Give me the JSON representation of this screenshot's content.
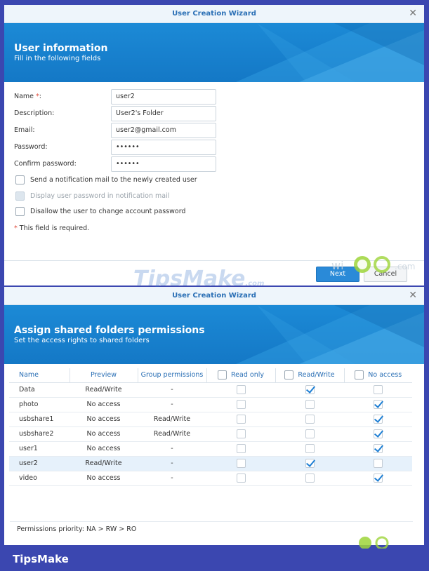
{
  "wizard1": {
    "title": "User Creation Wizard",
    "banner_title": "User information",
    "banner_subtitle": "Fill in the following fields",
    "fields": [
      {
        "label": "Name ",
        "required_mark": "*",
        "colon": ":",
        "value": "user2"
      },
      {
        "label": "Description:",
        "required_mark": "",
        "colon": "",
        "value": "User2's Folder"
      },
      {
        "label": "Email:",
        "required_mark": "",
        "colon": "",
        "value": "user2@gmail.com"
      },
      {
        "label": "Password:",
        "required_mark": "",
        "colon": "",
        "value": "••••••"
      },
      {
        "label": "Confirm password:",
        "required_mark": "",
        "colon": "",
        "value": "••••••"
      }
    ],
    "checkboxes": [
      {
        "label": "Send a notification mail to the newly created user",
        "checked": false,
        "disabled": false
      },
      {
        "label": "Display user password in notification mail",
        "checked": false,
        "disabled": true
      },
      {
        "label": "Disallow the user to change account password",
        "checked": false,
        "disabled": false
      }
    ],
    "required_note_mark": "*",
    "required_note": " This field is required.",
    "next_label": "Next",
    "cancel_label": "Cancel"
  },
  "watermark": {
    "text": "TipsMake",
    "suffix": ".com"
  },
  "logo_text": "wi Z .com",
  "wizard2": {
    "title": "User Creation Wizard",
    "banner_title": "Assign shared folders permissions",
    "banner_subtitle": "Set the access rights to shared folders",
    "columns": {
      "name": "Name",
      "preview": "Preview",
      "group": "Group permissions",
      "read_only": "Read only",
      "read_write": "Read/Write",
      "no_access": "No access"
    },
    "rows": [
      {
        "name": "Data",
        "preview": "Read/Write",
        "group": "-",
        "perm": "read_write",
        "selected": false
      },
      {
        "name": "photo",
        "preview": "No access",
        "group": "-",
        "perm": "no_access",
        "selected": false
      },
      {
        "name": "usbshare1",
        "preview": "No access",
        "group": "Read/Write",
        "perm": "no_access",
        "selected": false
      },
      {
        "name": "usbshare2",
        "preview": "No access",
        "group": "Read/Write",
        "perm": "no_access",
        "selected": false
      },
      {
        "name": "user1",
        "preview": "No access",
        "group": "-",
        "perm": "no_access",
        "selected": false
      },
      {
        "name": "user2",
        "preview": "Read/Write",
        "group": "-",
        "perm": "read_write",
        "selected": true
      },
      {
        "name": "video",
        "preview": "No access",
        "group": "-",
        "perm": "no_access",
        "selected": false
      }
    ],
    "priority_note": "Permissions priority: NA > RW > RO"
  },
  "brand": "TipsMake",
  "colors": {
    "accent": "#1c8ad6",
    "orange": "#e88b1a",
    "red": "#d8342a",
    "frame": "#3b47b0"
  }
}
